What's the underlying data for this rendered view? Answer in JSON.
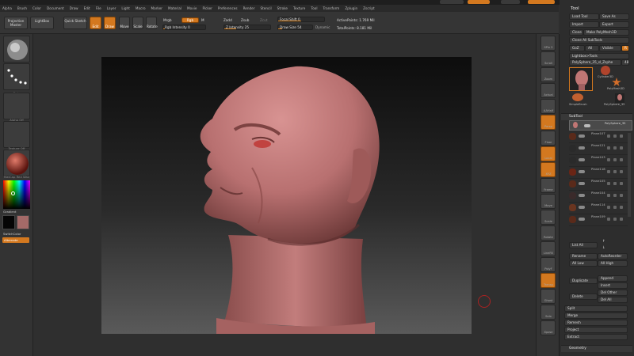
{
  "menu": [
    "Alpha",
    "Brush",
    "Color",
    "Document",
    "Draw",
    "Edit",
    "File",
    "Layer",
    "Light",
    "Macro",
    "Marker",
    "Material",
    "Movie",
    "Picker",
    "Preferences",
    "Render",
    "Stencil",
    "Stroke",
    "Texture",
    "Tool",
    "Transform",
    "Zplugin",
    "Zscript"
  ],
  "toolbar": {
    "projection_master": "Projection Master",
    "lightbox": "LightBox",
    "quick_sketch": "Quick Sketch",
    "edit": "Edit",
    "draw": "Draw",
    "move": "Move",
    "scale": "Scale",
    "rotate": "Rotate",
    "mrgb": "Mrgb",
    "rgb": "Rgb",
    "m": "M",
    "rgb_intensity": "Rgb Intensity 0",
    "zadd": "Zadd",
    "zsub": "Zsub",
    "zcut": "Zcut",
    "z_intensity": "Z Intensity 25",
    "focal_shift": "Focal Shift 0",
    "draw_size": "Draw Size 54",
    "dynamic": "Dynamic",
    "active_points": "ActivePoints: 1.769 Mil",
    "total_points": "TotalPoints: 8.181 Mil"
  },
  "left_shelf": {
    "items": [
      "Standard",
      "Dots",
      "Alpha Off",
      "Texture Off",
      "MatCap Red Wax"
    ],
    "gradient": "Gradient",
    "switch_color": "SwitchColor",
    "alternate": "Alternate"
  },
  "right_shelf": {
    "items": [
      "SPix 3",
      "Scroll",
      "Zoom",
      "Actual",
      "AAHalf",
      "Persp",
      "Floor",
      "Local",
      "XYZ",
      "Frame",
      "Move",
      "Scale",
      "Rotate",
      "LineFill",
      "PolyF",
      "Transp",
      "Ghost",
      "Solo",
      "Xpose"
    ]
  },
  "tool_panel": {
    "title": "Tool",
    "load_tool": "Load Tool",
    "save_as": "Save As",
    "import": "Import",
    "export": "Export",
    "clone": "Clone",
    "make_polymesh": "Make PolyMesh3D",
    "clone_all_subtools": "Clone All SubTools",
    "goz": "GoZ",
    "all": "All",
    "visible": "Visible",
    "r": "R",
    "lightbox_tools": "Lightbox>Tools",
    "current_tool": "PolySphere_35_sl_Zsphe",
    "current_tool_count": "48",
    "tool_thumbs": [
      "Cylinder3D",
      "PolyMesh3D",
      "SimpleBrush",
      "PolySphere_35"
    ],
    "subtool_header": "SubTool",
    "subtools": [
      "PolySphere_35",
      "Plane107",
      "Plane121",
      "Plane103",
      "Plane118",
      "Plane105",
      "Plane104",
      "Plane114",
      "Plane109"
    ],
    "list_all": "List All",
    "rename": "Rename",
    "autoreorder": "AutoReorder",
    "all_low": "All Low",
    "all_high": "All High",
    "duplicate": "Duplicate",
    "append": "Append",
    "insert": "Insert",
    "delete": "Delete",
    "del_other": "Del Other",
    "del_all": "Del All",
    "split": "Split",
    "merge": "Merge",
    "remesh": "Remesh",
    "project": "Project",
    "extract": "Extract",
    "geometry": "Geometry"
  },
  "colors": {
    "accent": "#d3781f",
    "skin": "#c07674",
    "canvas_top": "#0d0d0d",
    "canvas_bottom": "#5a5a5a"
  }
}
